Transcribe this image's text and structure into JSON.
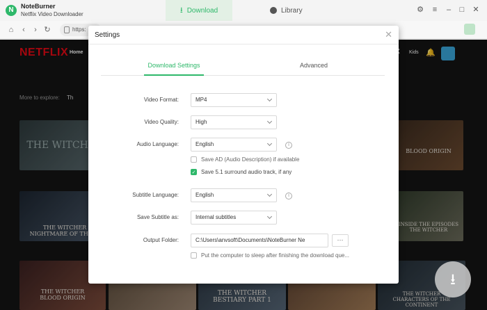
{
  "app": {
    "name": "NoteBurner",
    "subtitle": "Netflix Video Downloader",
    "logo": "▣"
  },
  "tabs": {
    "download": "Download",
    "library": "Library"
  },
  "browser": {
    "url": "https:"
  },
  "netflix": {
    "logo": "NETFLIX",
    "home": "Home",
    "explore": "More to explore:",
    "explore_item": "Th",
    "kids": "Kids"
  },
  "tiles": {
    "t1": "THE WITCHER",
    "t2": "THE WITCHER\nNIGHTMARE OF THE W",
    "t3": "BLOOD ORIGIN",
    "t4": "THE WITCHER\nBLOOD ORIGIN",
    "t5": "INSIDE THE EPISODES\nTHE WITCHER",
    "t6": "THE WITCHER\nBESTIARY PART 1",
    "t7": "THE WITCHER\nCHARACTERS OF THE CONTINENT"
  },
  "settings": {
    "title": "Settings",
    "tab_download": "Download Settings",
    "tab_advanced": "Advanced",
    "video_format_label": "Video Format:",
    "video_format": "MP4",
    "video_quality_label": "Video Quality:",
    "video_quality": "High",
    "audio_language_label": "Audio Language:",
    "audio_language": "English",
    "save_ad": "Save AD (Audio Description) if available",
    "save_51": "Save 5.1 surround audio track, if any",
    "subtitle_language_label": "Subtitle Language:",
    "subtitle_language": "English",
    "save_subtitle_label": "Save Subtitle as:",
    "save_subtitle": "Internal subtitles",
    "output_folder_label": "Output Folder:",
    "output_folder": "C:\\Users\\anvsoft\\Documents\\NoteBurner Ne",
    "browse": "···",
    "sleep": "Put the computer to sleep after finishing the download que..."
  },
  "colors": {
    "accent": "#2eb86a",
    "netflix_red": "#e50914"
  }
}
